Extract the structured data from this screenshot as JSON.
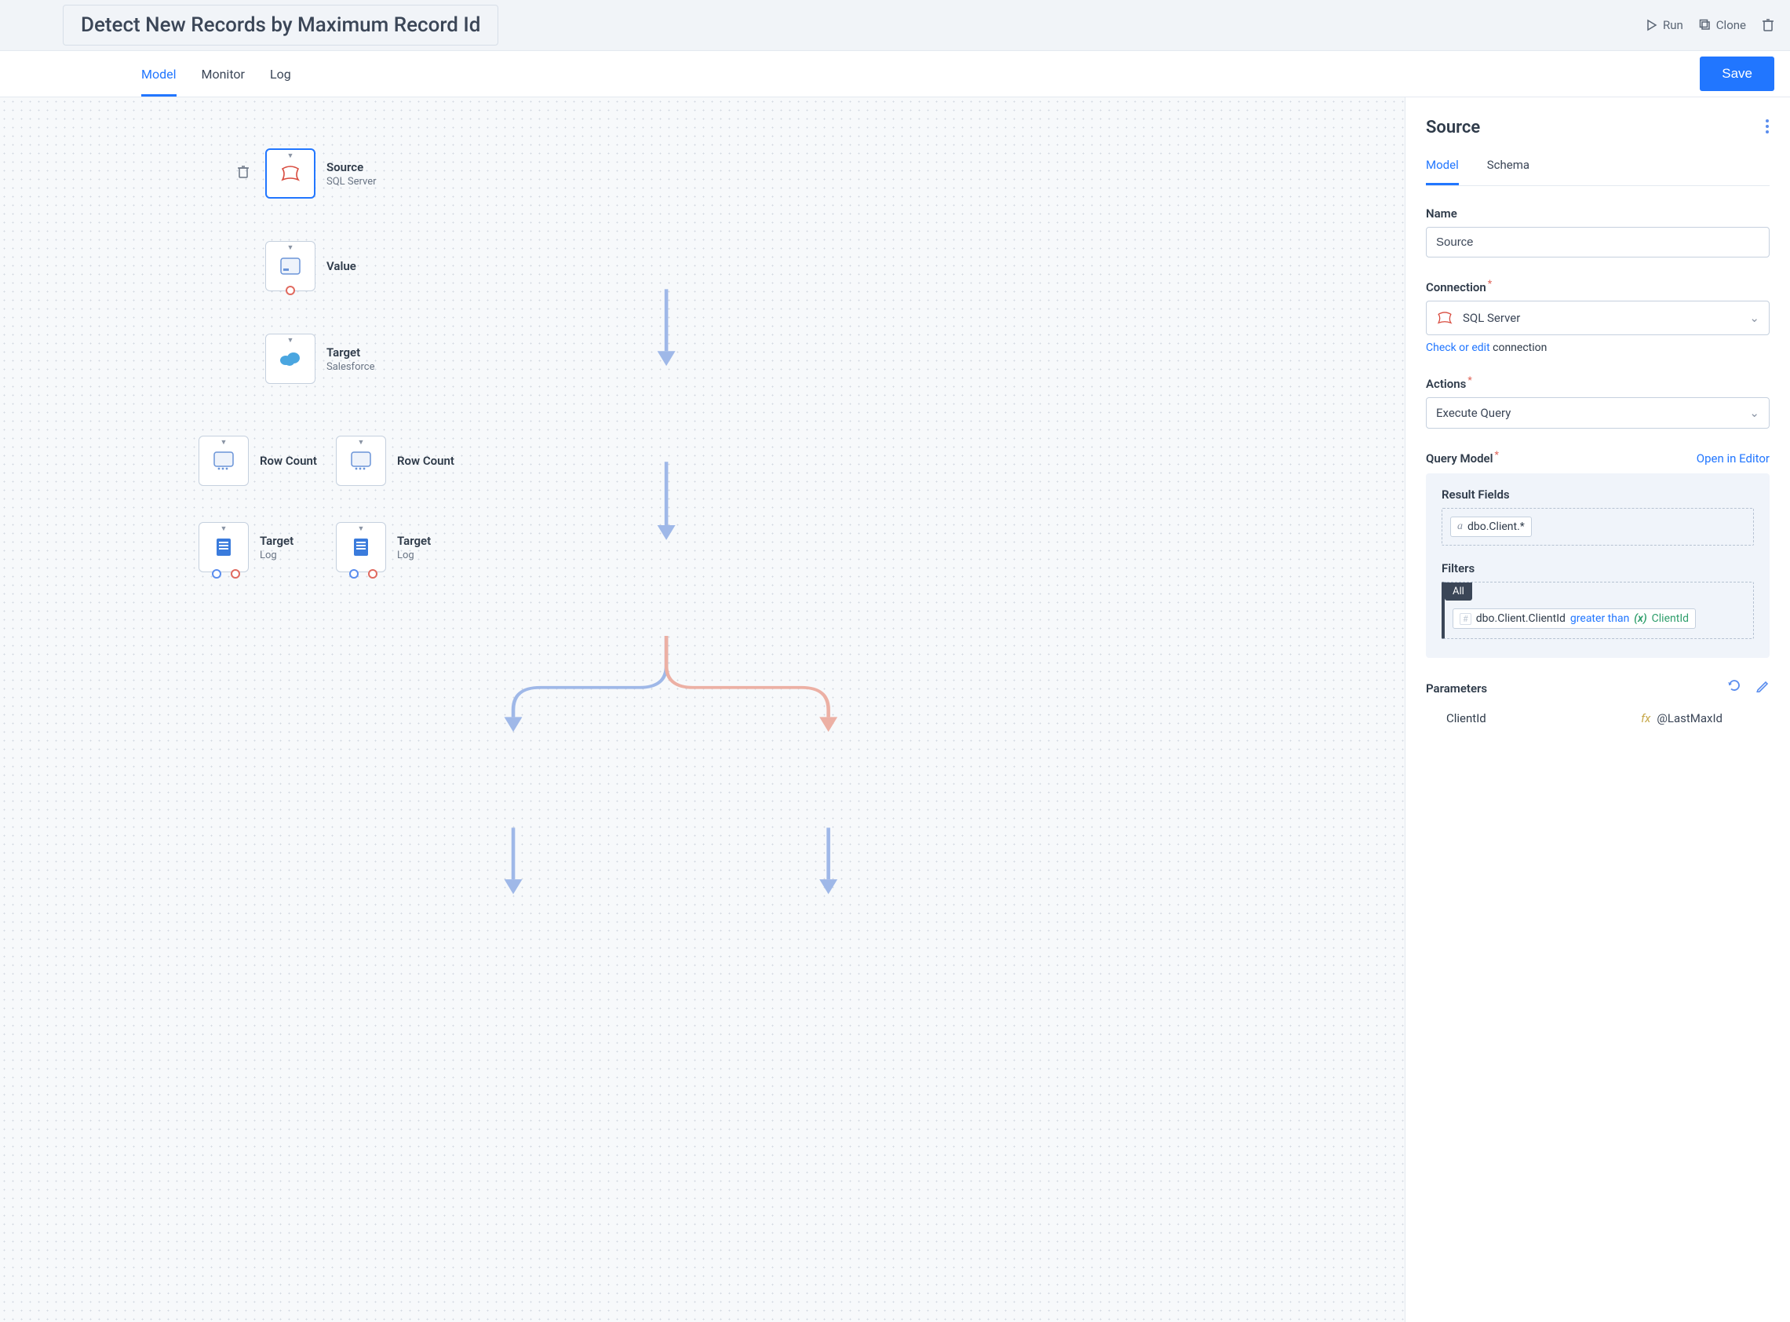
{
  "header": {
    "title": "Detect New Records by Maximum Record Id",
    "run_label": "Run",
    "clone_label": "Clone"
  },
  "tabs": {
    "model": "Model",
    "monitor": "Monitor",
    "log": "Log",
    "save": "Save"
  },
  "canvas": {
    "nodes": {
      "source": {
        "title": "Source",
        "sub": "SQL Server"
      },
      "value": {
        "title": "Value"
      },
      "target1": {
        "title": "Target",
        "sub": "Salesforce"
      },
      "rowcountL": {
        "title": "Row Count"
      },
      "rowcountR": {
        "title": "Row Count"
      },
      "targetL": {
        "title": "Target",
        "sub": "Log"
      },
      "targetR": {
        "title": "Target",
        "sub": "Log"
      }
    }
  },
  "panel": {
    "title": "Source",
    "tabs": {
      "model": "Model",
      "schema": "Schema"
    },
    "name_label": "Name",
    "name_value": "Source",
    "connection_label": "Connection",
    "connection_value": "SQL Server",
    "check_edit_link": "Check or edit",
    "check_edit_suffix": "connection",
    "actions_label": "Actions",
    "actions_value": "Execute Query",
    "query_model_label": "Query Model",
    "open_in_editor": "Open in Editor",
    "result_fields_label": "Result Fields",
    "result_field_value": "dbo.Client.*",
    "filters_label": "Filters",
    "filters_all": "All",
    "filter_field": "dbo.Client.ClientId",
    "filter_op": "greater than",
    "filter_fx": "(x)",
    "filter_param": "ClientId",
    "parameters_label": "Parameters",
    "param_name": "ClientId",
    "param_fx": "fx",
    "param_value": "@LastMaxId"
  }
}
